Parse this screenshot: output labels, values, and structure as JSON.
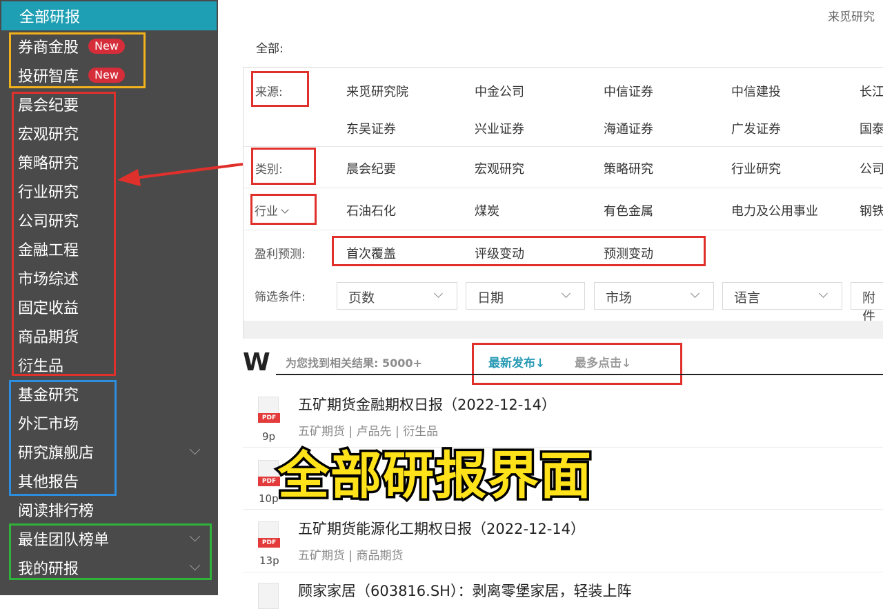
{
  "sidebar": {
    "active": "全部研报",
    "items": [
      {
        "label": "券商金股",
        "badge": "New"
      },
      {
        "label": "投研智库",
        "badge": "New"
      },
      {
        "label": "晨会纪要"
      },
      {
        "label": "宏观研究"
      },
      {
        "label": "策略研究"
      },
      {
        "label": "行业研究"
      },
      {
        "label": "公司研究"
      },
      {
        "label": "金融工程"
      },
      {
        "label": "市场综述"
      },
      {
        "label": "固定收益"
      },
      {
        "label": "商品期货"
      },
      {
        "label": "衍生品"
      },
      {
        "label": "基金研究"
      },
      {
        "label": "外汇市场"
      },
      {
        "label": "研究旗舰店"
      },
      {
        "label": "其他报告"
      },
      {
        "label": "阅读排行榜"
      },
      {
        "label": "最佳团队榜单"
      },
      {
        "label": "我的研报"
      }
    ]
  },
  "header": {
    "top_right": "来觅研究",
    "all_label": "全部:"
  },
  "filters": {
    "source": {
      "label": "来源:",
      "options": [
        "来觅研究院",
        "中金公司",
        "中信证券",
        "中信建投",
        "长江",
        "东吴证券",
        "兴业证券",
        "海通证券",
        "广发证券",
        "国泰"
      ]
    },
    "category": {
      "label": "类别:",
      "options": [
        "晨会纪要",
        "宏观研究",
        "策略研究",
        "行业研究",
        "公司"
      ]
    },
    "industry": {
      "label": "行业",
      "options": [
        "石油石化",
        "煤炭",
        "有色金属",
        "电力及公用事业",
        "钢铁"
      ]
    },
    "forecast": {
      "label": "盈利预测:",
      "options": [
        "首次覆盖",
        "评级变动",
        "预测变动"
      ]
    },
    "conditions": {
      "label": "筛选条件:",
      "selects": [
        "页数",
        "日期",
        "市场",
        "语言",
        "附件"
      ]
    }
  },
  "results": {
    "logo": "W",
    "count_text": "为您找到相关结果: 5000+",
    "sort_latest": "最新发布↓",
    "sort_most_clicked": "最多点击↓",
    "pdf_tag": "PDF",
    "items": [
      {
        "title": "五矿期货金融期权日报（2022-12-14）",
        "meta": "五矿期货 | 卢品先 | 衍生品",
        "pages": "9p"
      },
      {
        "title": "",
        "meta": "",
        "pages": "10p"
      },
      {
        "title": "五矿期货能源化工期权日报（2022-12-14）",
        "meta": "五矿期货 | 商品期货",
        "pages": "13p"
      },
      {
        "title": "顾家家居（603816.SH）：剥离零堡家居，轻装上阵",
        "meta": "",
        "pages": ""
      }
    ]
  },
  "overlay_caption": "全部研报界面",
  "colors": {
    "sidebar_bg": "#4a4a4a",
    "active": "#1e9fb4",
    "badge": "#d62d3a",
    "accent": "#2a9bb5",
    "hl_yellow": "#f2b21b",
    "hl_red": "#e0302b",
    "hl_blue": "#2d8ee0",
    "hl_green": "#2fb33a"
  }
}
